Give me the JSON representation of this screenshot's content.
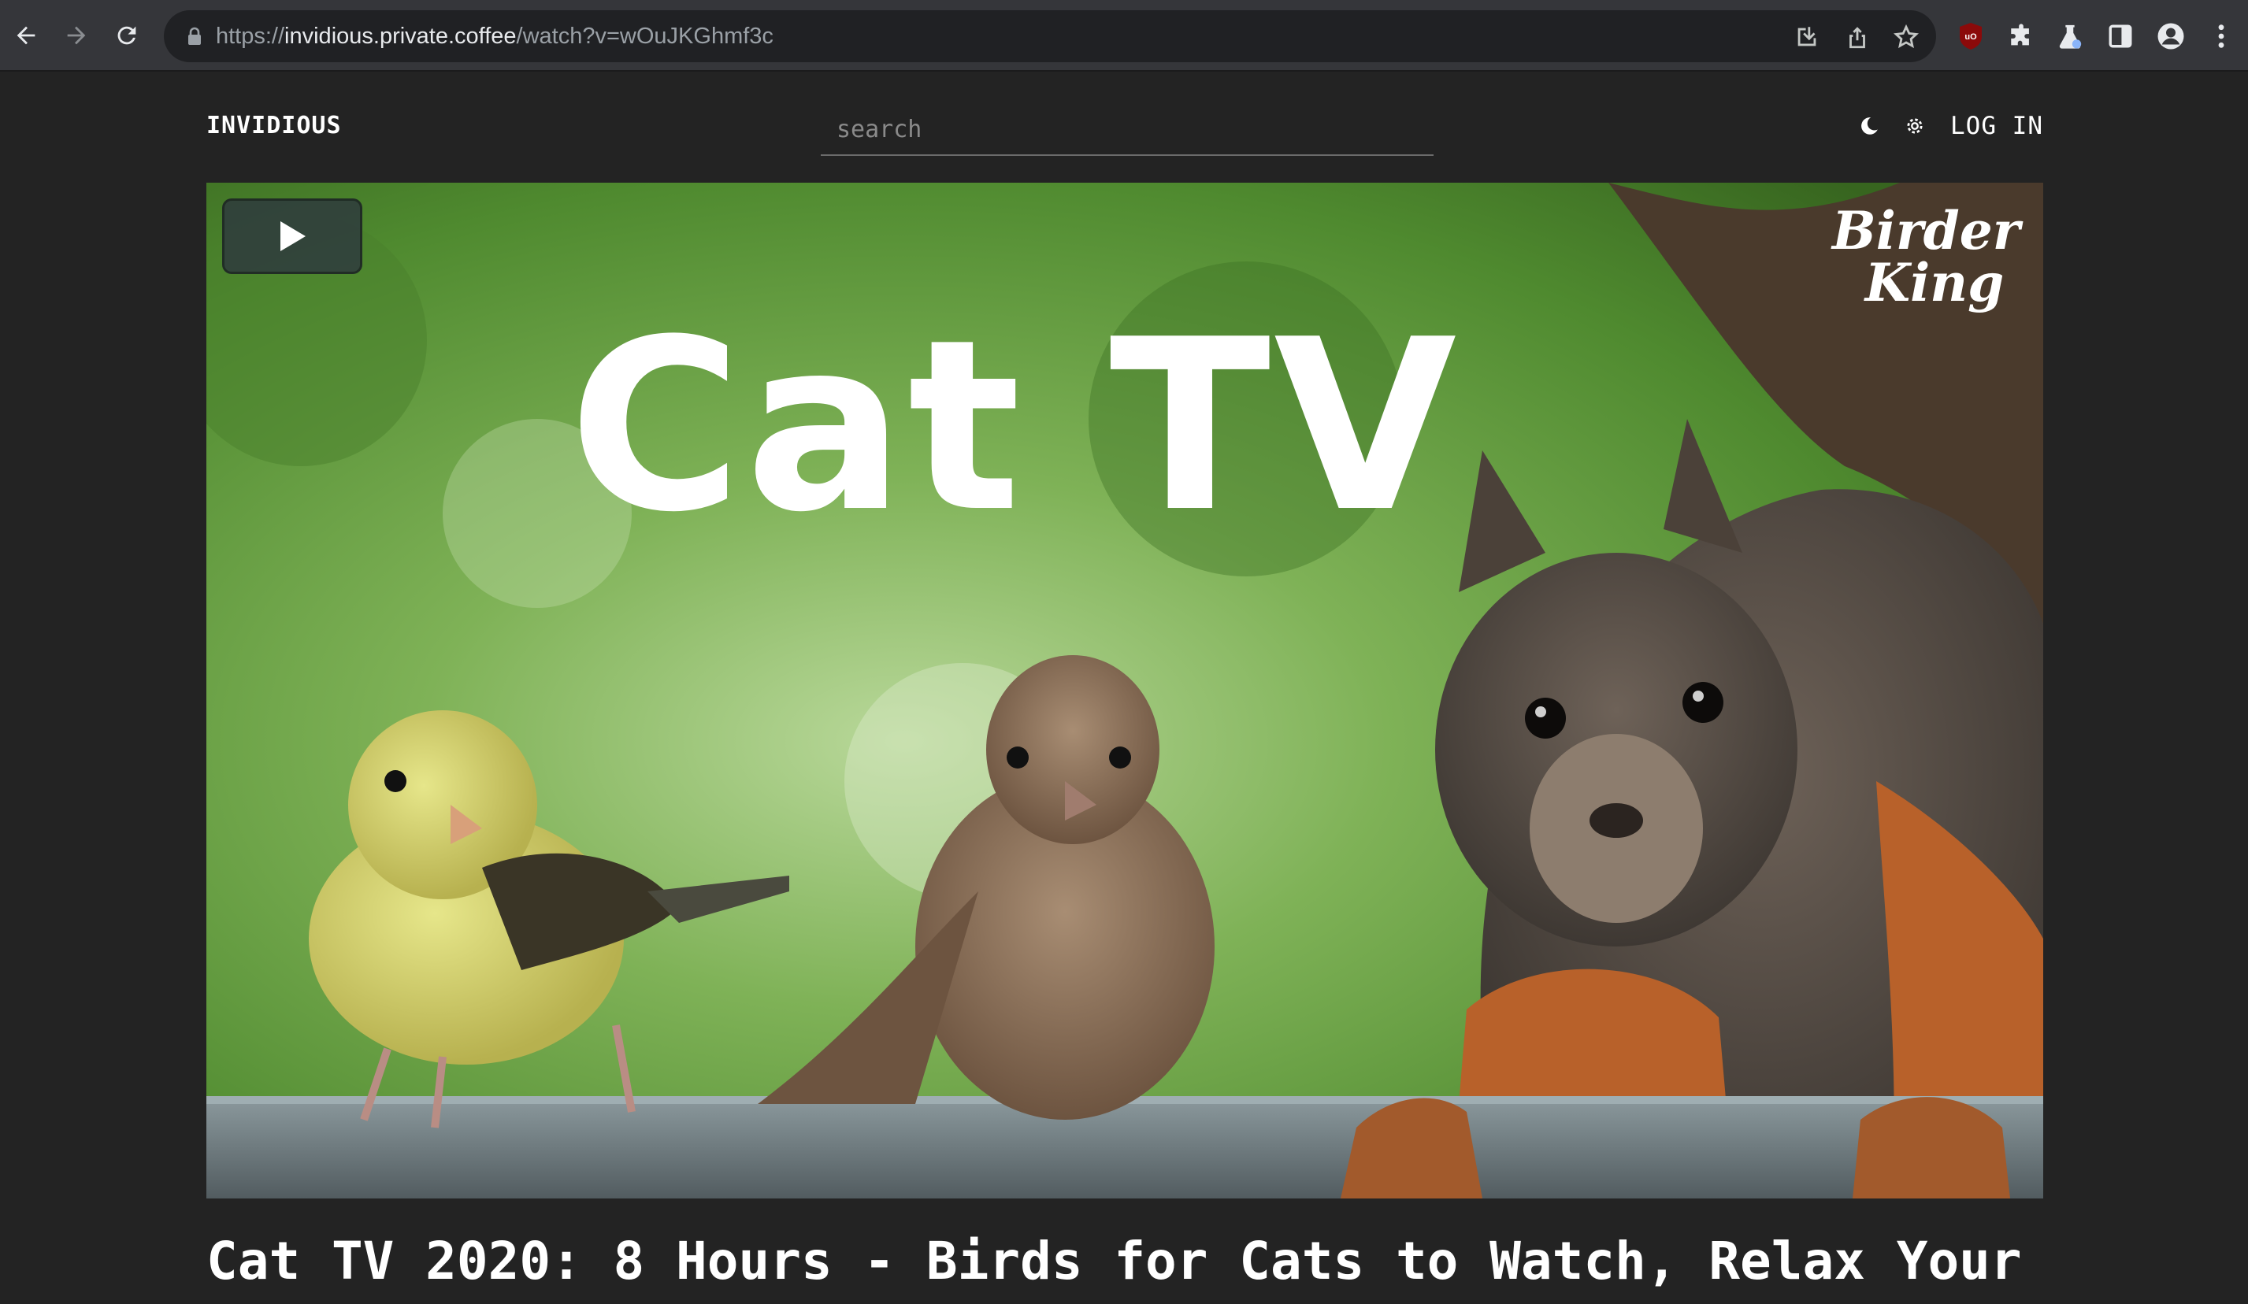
{
  "browser": {
    "url_scheme": "https://",
    "url_host": "invidious.private.coffee",
    "url_path": "/watch?v=wOuJKGhmf3c",
    "icons": [
      "back-icon",
      "forward-icon",
      "reload-icon",
      "lock-icon",
      "install-icon",
      "share-icon",
      "bookmark-star-icon",
      "ublock-icon",
      "extensions-icon",
      "labs-flask-icon",
      "side-panel-icon",
      "profile-icon",
      "menu-dots-icon"
    ],
    "ublock_label": "uO"
  },
  "header": {
    "logo": "INVIDIOUS",
    "search_placeholder": "search",
    "theme_icon": "moon-icon",
    "settings_icon": "gear-icon",
    "login_label": "LOG IN"
  },
  "player": {
    "thumbnail_title": "Cat TV",
    "brand_line1": "Birder",
    "brand_line2": "King",
    "play_icon": "play-icon"
  },
  "video": {
    "title": "Cat TV 2020: 8 Hours - Birds for Cats to Watch, Relax Your"
  },
  "colors": {
    "page_bg": "#232323",
    "chrome_bg": "#35363a",
    "omnibox_bg": "#202124",
    "text": "#ffffff"
  }
}
